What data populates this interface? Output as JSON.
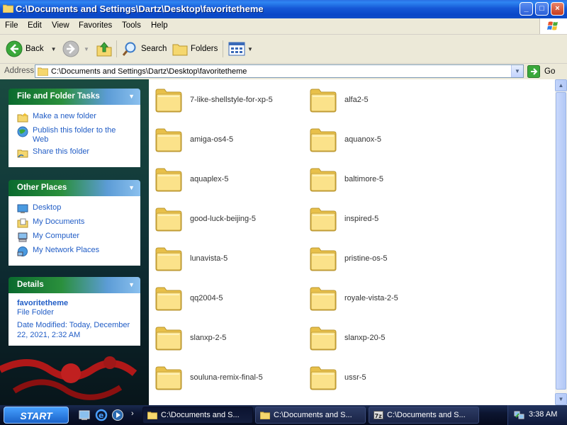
{
  "window": {
    "title": "C:\\Documents and Settings\\Dartz\\Desktop\\favoritetheme",
    "controls": [
      "_",
      "□",
      "×"
    ]
  },
  "menu": [
    "File",
    "Edit",
    "View",
    "Favorites",
    "Tools",
    "Help"
  ],
  "toolbar": {
    "back_label": "Back",
    "search_label": "Search",
    "folders_label": "Folders"
  },
  "address": {
    "label": "Address",
    "value": "C:\\Documents and Settings\\Dartz\\Desktop\\favoritetheme",
    "go_label": "Go"
  },
  "sidebar": {
    "file_tasks": {
      "title": "File and Folder Tasks",
      "items": [
        "Make a new folder",
        "Publish this folder to the Web",
        "Share this folder"
      ]
    },
    "other_places": {
      "title": "Other Places",
      "items": [
        "Desktop",
        "My Documents",
        "My Computer",
        "My Network Places"
      ]
    },
    "details": {
      "title": "Details",
      "name": "favoritetheme",
      "type": "File Folder",
      "modified": "Date Modified: Today, December 22, 2021, 2:32 AM"
    }
  },
  "folders": [
    "7-like-shellstyle-for-xp-5",
    "alfa2-5",
    "amiga-os4-5",
    "aquanox-5",
    "aquaplex-5",
    "baltimore-5",
    "good-luck-beijing-5",
    "inspired-5",
    "lunavista-5",
    "pristine-os-5",
    "qq2004-5",
    "royale-vista-2-5",
    "slanxp-2-5",
    "slanxp-20-5",
    "souluna-remix-final-5",
    "ussr-5"
  ],
  "taskbar": {
    "start_label": "START",
    "tasks": [
      "C:\\Documents and S...",
      "C:\\Documents and S...",
      "C:\\Documents and S..."
    ],
    "clock": "3:38 AM"
  }
}
